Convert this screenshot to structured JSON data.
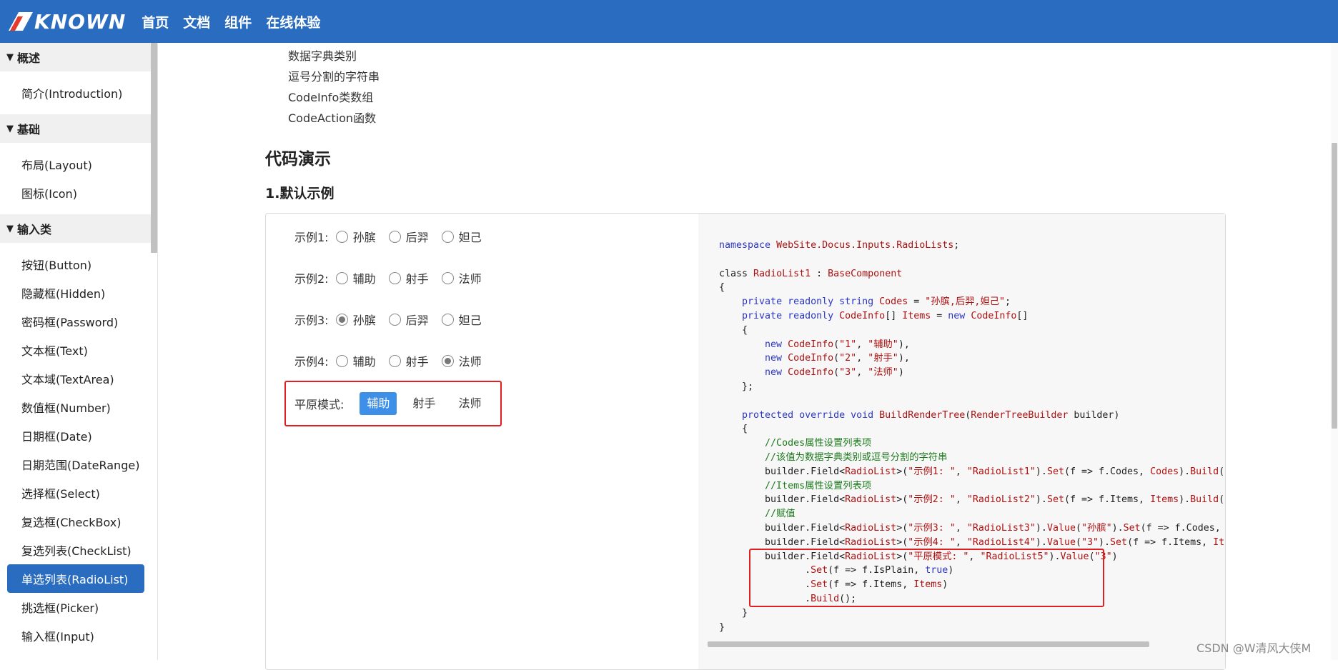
{
  "header": {
    "logo_text": "KNOWN",
    "nav": [
      "首页",
      "文档",
      "组件",
      "在线体验"
    ]
  },
  "sidebar": {
    "groups": [
      {
        "title": "概述",
        "items": [
          "简介(Introduction)"
        ]
      },
      {
        "title": "基础",
        "items": [
          "布局(Layout)",
          "图标(Icon)"
        ]
      },
      {
        "title": "输入类",
        "items": [
          "按钮(Button)",
          "隐藏框(Hidden)",
          "密码框(Password)",
          "文本框(Text)",
          "文本域(TextArea)",
          "数值框(Number)",
          "日期框(Date)",
          "日期范围(DateRange)",
          "选择框(Select)",
          "复选框(CheckBox)",
          "复选列表(CheckList)",
          "单选列表(RadioList)",
          "挑选框(Picker)",
          "输入框(Input)"
        ]
      }
    ],
    "active_item": "单选列表(RadioList)"
  },
  "content": {
    "codes_options": [
      "数据字典类别",
      "逗号分割的字符串",
      "CodeInfo类数组",
      "CodeAction函数"
    ],
    "section_title": "代码演示",
    "demo_title": "1.默认示例",
    "demo": {
      "rows": [
        {
          "label": "示例1:",
          "options": [
            "孙膑",
            "后羿",
            "妲己"
          ],
          "selected": -1
        },
        {
          "label": "示例2:",
          "options": [
            "辅助",
            "射手",
            "法师"
          ],
          "selected": -1
        },
        {
          "label": "示例3:",
          "options": [
            "孙膑",
            "后羿",
            "妲己"
          ],
          "selected": 0
        },
        {
          "label": "示例4:",
          "options": [
            "辅助",
            "射手",
            "法师"
          ],
          "selected": 2
        }
      ],
      "plain": {
        "label": "平原模式:",
        "options": [
          "辅助",
          "射手",
          "法师"
        ],
        "selected": 0
      }
    }
  },
  "watermark": "CSDN @W清风大侠M"
}
